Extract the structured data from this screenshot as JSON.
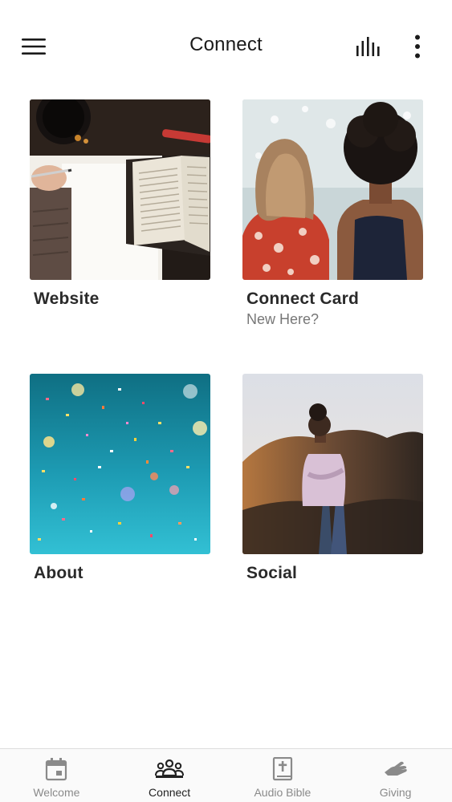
{
  "header": {
    "title": "Connect",
    "icons": [
      "menu-icon",
      "bar-chart-icon",
      "more-vertical-icon"
    ]
  },
  "tiles": [
    {
      "title": "Website",
      "subtitle": "",
      "image": "bible-notebook-photo"
    },
    {
      "title": "Connect Card",
      "subtitle": "New Here?",
      "image": "two-women-photo"
    },
    {
      "title": "About",
      "subtitle": "",
      "image": "confetti-photo"
    },
    {
      "title": "Social",
      "subtitle": "",
      "image": "woman-hillside-photo"
    }
  ],
  "tabbar": {
    "active": "Connect",
    "items": [
      {
        "label": "Welcome",
        "icon": "calendar-icon"
      },
      {
        "label": "Connect",
        "icon": "people-icon"
      },
      {
        "label": "Audio Bible",
        "icon": "bible-icon"
      },
      {
        "label": "Giving",
        "icon": "giving-hand-icon"
      }
    ]
  },
  "colors": {
    "accent": "#222222",
    "inactive": "#8a8a8a",
    "tabbar_bg": "#fafafa"
  }
}
